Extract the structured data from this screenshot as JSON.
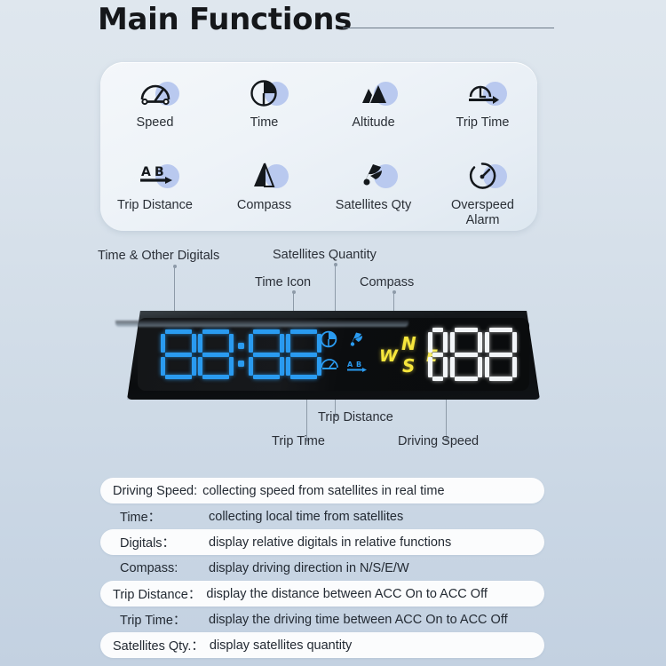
{
  "header": {
    "title": "Main Functions"
  },
  "functions_card": {
    "items": [
      {
        "icon": "speedometer-icon",
        "label": "Speed"
      },
      {
        "icon": "clock-pie-icon",
        "label": "Time"
      },
      {
        "icon": "mountain-icon",
        "label": "Altitude"
      },
      {
        "icon": "trip-time-icon",
        "label": "Trip Time"
      },
      {
        "icon": "a-to-b-arrow-icon",
        "label": "Trip Distance"
      },
      {
        "icon": "compass-needle-icon",
        "label": "Compass"
      },
      {
        "icon": "satellite-dish-icon",
        "label": "Satellites Qty"
      },
      {
        "icon": "overspeed-gauge-icon",
        "label": "Overspeed\nAlarm"
      }
    ]
  },
  "device": {
    "callouts_top": [
      {
        "text": "Time & Other Digitals"
      },
      {
        "text": "Satellites Quantity"
      },
      {
        "text": "Time Icon"
      },
      {
        "text": "Compass"
      }
    ],
    "callouts_bottom": [
      {
        "text": "Trip Distance"
      },
      {
        "text": "Trip Time"
      },
      {
        "text": "Driving Speed"
      }
    ],
    "display": {
      "time_value": "88:88",
      "time_color": "#2a9bf0",
      "speed_value": "188",
      "speed_color": "#f2f5f8",
      "compass_color": "#f6e63c",
      "compass_letters": {
        "west": "W",
        "north": "N",
        "south": "S",
        "east": "E"
      },
      "indicator_icons": [
        "clock-pie-icon",
        "speedometer-icon",
        "satellite-dish-icon",
        "a-to-b-arrow-icon"
      ]
    }
  },
  "spec_list": {
    "rows": [
      {
        "term": "Driving Speed:",
        "desc": "collecting speed from satellites in real time",
        "filled": true,
        "style": "wide"
      },
      {
        "term": "Time：",
        "desc": "collecting local time from satellites",
        "filled": false,
        "style": "indent"
      },
      {
        "term": "Digitals：",
        "desc": "display relative digitals in relative functions",
        "filled": true,
        "style": "indent"
      },
      {
        "term": "Compass:",
        "desc": "display driving direction in N/S/E/W",
        "filled": false,
        "style": "indent"
      },
      {
        "term": "Trip Distance：",
        "desc": "display the distance between ACC On to ACC Off",
        "filled": true,
        "style": "wide"
      },
      {
        "term": "Trip Time：",
        "desc": "display the driving time between ACC On to ACC Off",
        "filled": false,
        "style": "indent"
      },
      {
        "term": "Satellites Qty.：",
        "desc": "display satellites quantity",
        "filled": true,
        "style": "wide"
      }
    ]
  }
}
